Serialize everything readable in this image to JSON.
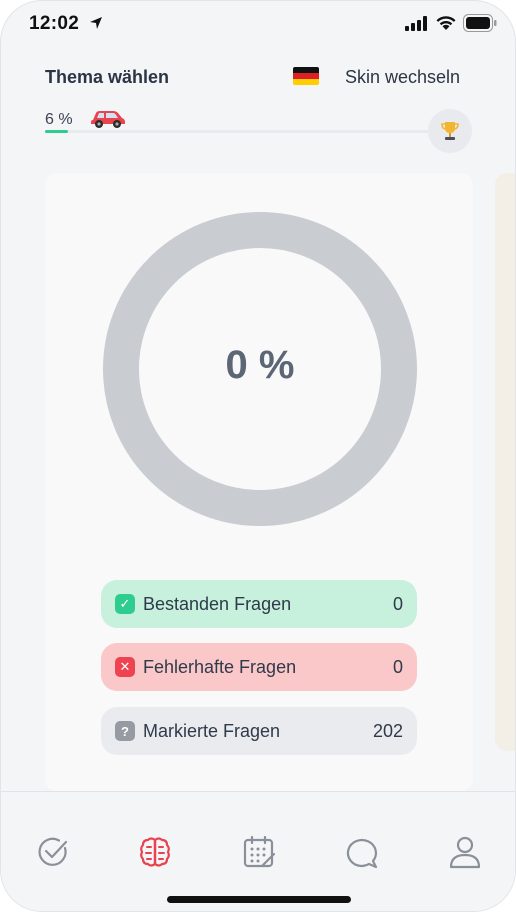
{
  "status_bar": {
    "time": "12:02",
    "icons": [
      "location-arrow-icon",
      "cellular-signal-icon",
      "wifi-icon",
      "battery-icon"
    ]
  },
  "header": {
    "title": "Thema wählen",
    "flag": "germany-flag-icon",
    "skin_label": "Skin wechseln"
  },
  "progress": {
    "label": "6 %",
    "value": 0.06,
    "icons": [
      "car-icon",
      "trophy-icon"
    ]
  },
  "card": {
    "donut_value": "0 %",
    "donut_fraction": 0,
    "stats": [
      {
        "label": "Bestanden Fragen",
        "count": "0",
        "icon": "check-icon"
      },
      {
        "label": "Fehlerhafte Fragen",
        "count": "0",
        "icon": "cross-icon"
      },
      {
        "label": "Markierte Fragen",
        "count": "202",
        "icon": "question-icon"
      }
    ]
  },
  "bottom_nav": {
    "items": [
      {
        "name": "tests",
        "icon": "check-circle-icon",
        "active": false
      },
      {
        "name": "learn",
        "icon": "brain-icon",
        "active": true
      },
      {
        "name": "calendar",
        "icon": "calendar-icon",
        "active": false
      },
      {
        "name": "chat",
        "icon": "chat-bubble-icon",
        "active": false
      },
      {
        "name": "profile",
        "icon": "user-icon",
        "active": false
      }
    ]
  },
  "colors": {
    "accent_active": "#e8434e",
    "progress_fill": "#2ecc8f",
    "passed_bg": "#c7f1dd",
    "failed_bg": "#fbc8ca",
    "marked_bg": "#e9ebee",
    "donut_ring": "#c9ccd1"
  }
}
